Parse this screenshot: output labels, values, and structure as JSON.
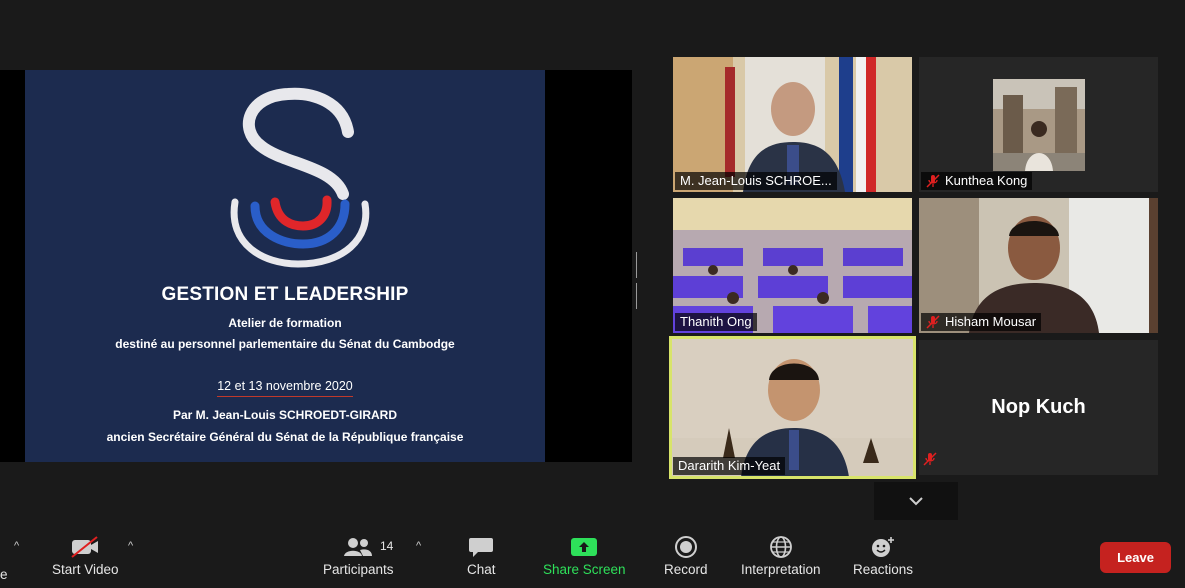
{
  "slide": {
    "title": "GESTION ET LEADERSHIP",
    "subtitle1": "Atelier de formation",
    "subtitle2": "destiné au personnel parlementaire du Sénat du Cambodge",
    "date": "12 et 13 novembre 2020",
    "presenter": "Par M. Jean-Louis SCHROEDT-GIRARD",
    "role": "ancien Secrétaire Général du Sénat de la République française"
  },
  "participants_tiles": [
    {
      "name": "M. Jean-Louis SCHROE...",
      "muted": false
    },
    {
      "name": "Kunthea Kong",
      "muted": true
    },
    {
      "name": "Thanith Ong",
      "muted": false
    },
    {
      "name": "Hisham Mousar",
      "muted": true
    },
    {
      "name": "Dararith Kim-Yeat",
      "muted": false,
      "active": true
    },
    {
      "name": "Nop Kuch",
      "muted": true,
      "video_off": true
    }
  ],
  "toolbar": {
    "cutoff_label": "e",
    "start_video": "Start Video",
    "participants": "Participants",
    "participants_count": "14",
    "chat": "Chat",
    "share_screen": "Share Screen",
    "record": "Record",
    "interpretation": "Interpretation",
    "reactions": "Reactions",
    "leave": "Leave"
  },
  "colors": {
    "slide_bg": "#1c2b4f",
    "active_speaker": "#d8e46a",
    "share_green": "#2ee05a",
    "leave_red": "#c5221f"
  }
}
